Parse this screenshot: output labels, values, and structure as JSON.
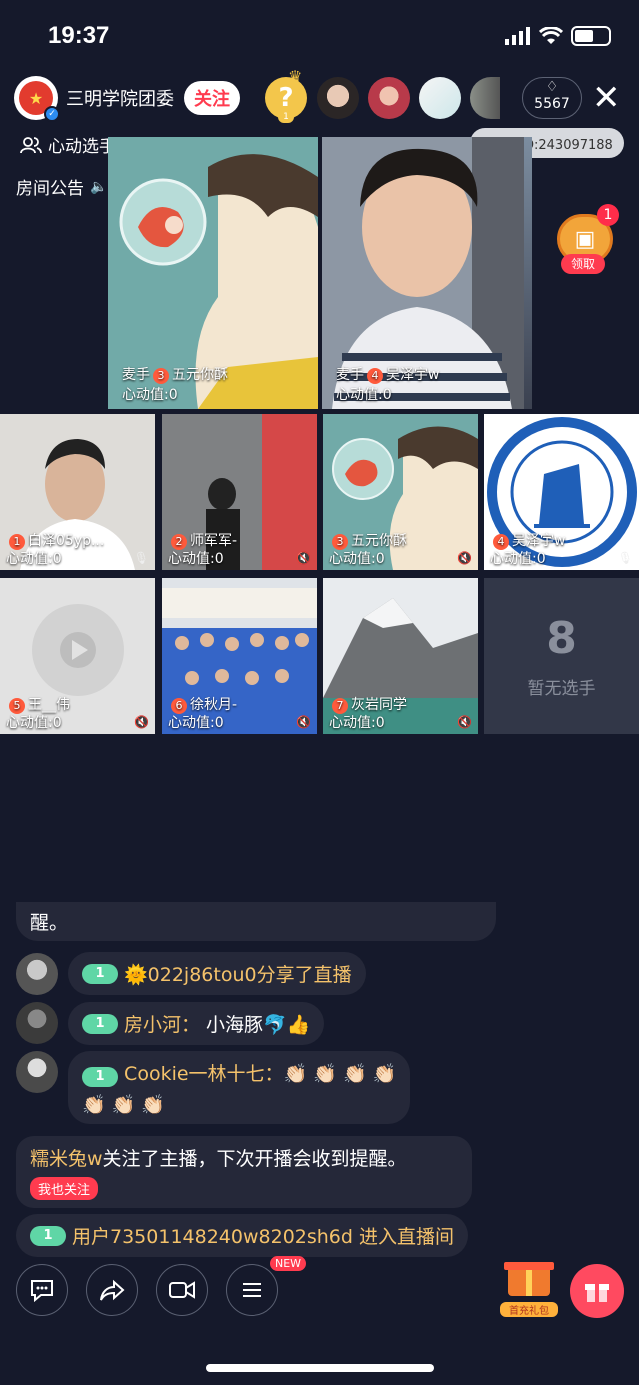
{
  "status": {
    "time": "19:37"
  },
  "host": {
    "name": "三明学院团委",
    "follow_label": "关注"
  },
  "viewers": {
    "hot_count": "5567",
    "rank_first": "1"
  },
  "header": {
    "rank_board_label": "心动选手榜",
    "live_id": "一直播ID:243097188",
    "notice_label": "房间公告"
  },
  "chest": {
    "badge": "1",
    "label": "领取"
  },
  "main_cams": [
    {
      "role": "麦手",
      "num": "3",
      "name": "五元你酥",
      "score": "心动值:0"
    },
    {
      "role": "麦手",
      "num": "4",
      "name": "吴泽宇w",
      "score": "心动值:0"
    }
  ],
  "contestants": [
    {
      "num": "1",
      "name": "白泽05yp...",
      "score": "心动值:0"
    },
    {
      "num": "2",
      "name": "师军军-",
      "score": "心动值:0"
    },
    {
      "num": "3",
      "name": "五元你酥",
      "score": "心动值:0"
    },
    {
      "num": "4",
      "name": "吴泽宇w",
      "score": "心动值:0"
    },
    {
      "num": "5",
      "name": "王__伟",
      "score": "心动值:0"
    },
    {
      "num": "6",
      "name": "徐秋月-",
      "score": "心动值:0"
    },
    {
      "num": "7",
      "name": "灰岩同学",
      "score": "心动值:0"
    }
  ],
  "empty_slot": {
    "num": "8",
    "label": "暂无选手"
  },
  "chat": {
    "partial": "醒。",
    "msg1": {
      "level": "1",
      "text": "🌞022j86tou0分享了直播"
    },
    "msg2": {
      "level": "1",
      "user": "房小河：",
      "text": "小海豚🐬👍"
    },
    "msg3": {
      "level": "1",
      "user": "Cookie一林十七：",
      "line1": "👏🏻 👏🏻 👏🏻 👏🏻",
      "line2": "👏🏻 👏🏻 👏🏻"
    },
    "follow_notice": {
      "user": "糯米兔w",
      "text": "关注了主播，下次开播会收到提醒。",
      "button": "我也关注"
    },
    "enter": {
      "level": "1",
      "text": "用户73501148240w8202sh6d 进入直播间"
    }
  },
  "toolbar": {
    "new_tag": "NEW",
    "recharge_label": "首充礼包"
  }
}
